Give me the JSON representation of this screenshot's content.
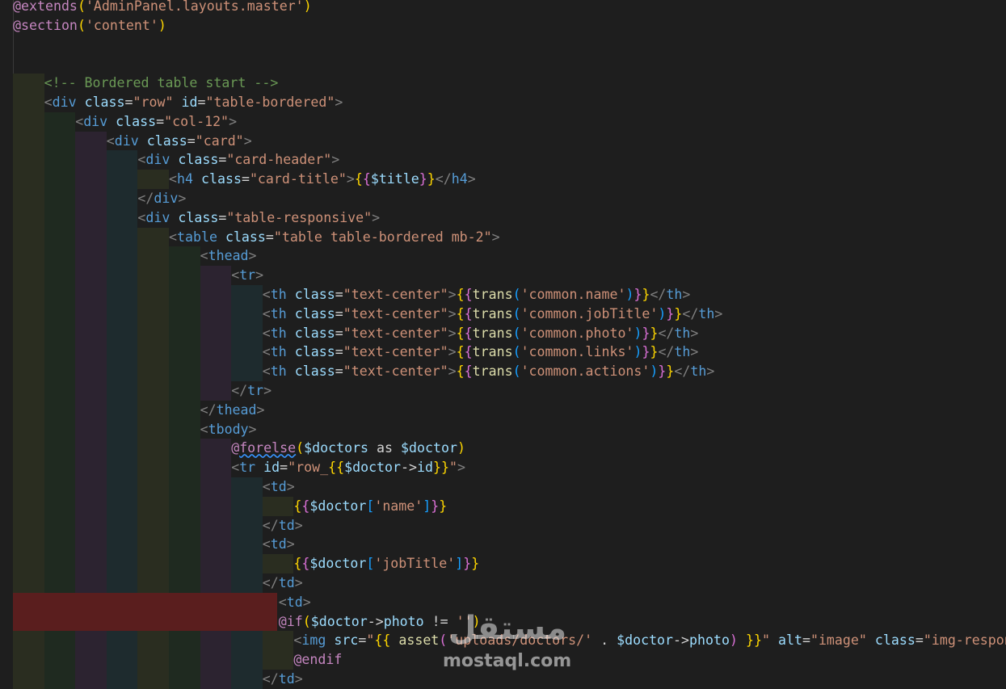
{
  "editor": {
    "lines": [
      {
        "indent": 0,
        "red": false,
        "tokens": [
          [
            "dir",
            "@extends"
          ],
          [
            "b1",
            "("
          ],
          [
            "str",
            "'AdminPanel.layouts.master'"
          ],
          [
            "b1",
            ")"
          ]
        ]
      },
      {
        "indent": 0,
        "red": false,
        "tokens": [
          [
            "dir",
            "@section"
          ],
          [
            "b1",
            "("
          ],
          [
            "str",
            "'content'"
          ],
          [
            "b1",
            ")"
          ]
        ]
      },
      {
        "indent": 0,
        "red": false,
        "tokens": []
      },
      {
        "indent": 0,
        "red": false,
        "tokens": []
      },
      {
        "indent": 1,
        "red": false,
        "tokens": [
          [
            "cmt",
            "<!-- Bordered table start -->"
          ]
        ]
      },
      {
        "indent": 1,
        "red": false,
        "tokens": [
          [
            "brk",
            "<"
          ],
          [
            "kw",
            "div"
          ],
          [
            "tx",
            " "
          ],
          [
            "att",
            "class"
          ],
          [
            "tx",
            "="
          ],
          [
            "str",
            "\"row\""
          ],
          [
            "tx",
            " "
          ],
          [
            "att",
            "id"
          ],
          [
            "tx",
            "="
          ],
          [
            "str",
            "\"table-bordered\""
          ],
          [
            "brk",
            ">"
          ]
        ]
      },
      {
        "indent": 2,
        "red": false,
        "tokens": [
          [
            "brk",
            "<"
          ],
          [
            "kw",
            "div"
          ],
          [
            "tx",
            " "
          ],
          [
            "att",
            "class"
          ],
          [
            "tx",
            "="
          ],
          [
            "str",
            "\"col-12\""
          ],
          [
            "brk",
            ">"
          ]
        ]
      },
      {
        "indent": 3,
        "red": false,
        "tokens": [
          [
            "brk",
            "<"
          ],
          [
            "kw",
            "div"
          ],
          [
            "tx",
            " "
          ],
          [
            "att",
            "class"
          ],
          [
            "tx",
            "="
          ],
          [
            "str",
            "\"card\""
          ],
          [
            "brk",
            ">"
          ]
        ]
      },
      {
        "indent": 4,
        "red": false,
        "tokens": [
          [
            "brk",
            "<"
          ],
          [
            "kw",
            "div"
          ],
          [
            "tx",
            " "
          ],
          [
            "att",
            "class"
          ],
          [
            "tx",
            "="
          ],
          [
            "str",
            "\"card-header\""
          ],
          [
            "brk",
            ">"
          ]
        ]
      },
      {
        "indent": 5,
        "red": false,
        "tokens": [
          [
            "brk",
            "<"
          ],
          [
            "kw",
            "h4"
          ],
          [
            "tx",
            " "
          ],
          [
            "att",
            "class"
          ],
          [
            "tx",
            "="
          ],
          [
            "str",
            "\"card-title\""
          ],
          [
            "brk",
            ">"
          ],
          [
            "b1",
            "{"
          ],
          [
            "b2",
            "{"
          ],
          [
            "var",
            "$title"
          ],
          [
            "b2",
            "}"
          ],
          [
            "b1",
            "}"
          ],
          [
            "brk",
            "</"
          ],
          [
            "kw",
            "h4"
          ],
          [
            "brk",
            ">"
          ]
        ]
      },
      {
        "indent": 4,
        "red": false,
        "tokens": [
          [
            "brk",
            "</"
          ],
          [
            "kw",
            "div"
          ],
          [
            "brk",
            ">"
          ]
        ]
      },
      {
        "indent": 4,
        "red": false,
        "tokens": [
          [
            "brk",
            "<"
          ],
          [
            "kw",
            "div"
          ],
          [
            "tx",
            " "
          ],
          [
            "att",
            "class"
          ],
          [
            "tx",
            "="
          ],
          [
            "str",
            "\"table-responsive\""
          ],
          [
            "brk",
            ">"
          ]
        ]
      },
      {
        "indent": 5,
        "red": false,
        "tokens": [
          [
            "brk",
            "<"
          ],
          [
            "kw",
            "table"
          ],
          [
            "tx",
            " "
          ],
          [
            "att",
            "class"
          ],
          [
            "tx",
            "="
          ],
          [
            "str",
            "\"table table-bordered mb-2\""
          ],
          [
            "brk",
            ">"
          ]
        ]
      },
      {
        "indent": 6,
        "red": false,
        "tokens": [
          [
            "brk",
            "<"
          ],
          [
            "kw",
            "thead"
          ],
          [
            "brk",
            ">"
          ]
        ]
      },
      {
        "indent": 7,
        "red": false,
        "tokens": [
          [
            "brk",
            "<"
          ],
          [
            "kw",
            "tr"
          ],
          [
            "brk",
            ">"
          ]
        ]
      },
      {
        "indent": 8,
        "red": false,
        "tokens": [
          [
            "brk",
            "<"
          ],
          [
            "kw",
            "th"
          ],
          [
            "tx",
            " "
          ],
          [
            "att",
            "class"
          ],
          [
            "tx",
            "="
          ],
          [
            "str",
            "\"text-center\""
          ],
          [
            "brk",
            ">"
          ],
          [
            "b1",
            "{"
          ],
          [
            "b2",
            "{"
          ],
          [
            "fn",
            "trans"
          ],
          [
            "b3",
            "("
          ],
          [
            "str",
            "'common.name'"
          ],
          [
            "b3",
            ")"
          ],
          [
            "b2",
            "}"
          ],
          [
            "b1",
            "}"
          ],
          [
            "brk",
            "</"
          ],
          [
            "kw",
            "th"
          ],
          [
            "brk",
            ">"
          ]
        ]
      },
      {
        "indent": 8,
        "red": false,
        "tokens": [
          [
            "brk",
            "<"
          ],
          [
            "kw",
            "th"
          ],
          [
            "tx",
            " "
          ],
          [
            "att",
            "class"
          ],
          [
            "tx",
            "="
          ],
          [
            "str",
            "\"text-center\""
          ],
          [
            "brk",
            ">"
          ],
          [
            "b1",
            "{"
          ],
          [
            "b2",
            "{"
          ],
          [
            "fn",
            "trans"
          ],
          [
            "b3",
            "("
          ],
          [
            "str",
            "'common.jobTitle'"
          ],
          [
            "b3",
            ")"
          ],
          [
            "b2",
            "}"
          ],
          [
            "b1",
            "}"
          ],
          [
            "brk",
            "</"
          ],
          [
            "kw",
            "th"
          ],
          [
            "brk",
            ">"
          ]
        ]
      },
      {
        "indent": 8,
        "red": false,
        "tokens": [
          [
            "brk",
            "<"
          ],
          [
            "kw",
            "th"
          ],
          [
            "tx",
            " "
          ],
          [
            "att",
            "class"
          ],
          [
            "tx",
            "="
          ],
          [
            "str",
            "\"text-center\""
          ],
          [
            "brk",
            ">"
          ],
          [
            "b1",
            "{"
          ],
          [
            "b2",
            "{"
          ],
          [
            "fn",
            "trans"
          ],
          [
            "b3",
            "("
          ],
          [
            "str",
            "'common.photo'"
          ],
          [
            "b3",
            ")"
          ],
          [
            "b2",
            "}"
          ],
          [
            "b1",
            "}"
          ],
          [
            "brk",
            "</"
          ],
          [
            "kw",
            "th"
          ],
          [
            "brk",
            ">"
          ]
        ]
      },
      {
        "indent": 8,
        "red": false,
        "tokens": [
          [
            "brk",
            "<"
          ],
          [
            "kw",
            "th"
          ],
          [
            "tx",
            " "
          ],
          [
            "att",
            "class"
          ],
          [
            "tx",
            "="
          ],
          [
            "str",
            "\"text-center\""
          ],
          [
            "brk",
            ">"
          ],
          [
            "b1",
            "{"
          ],
          [
            "b2",
            "{"
          ],
          [
            "fn",
            "trans"
          ],
          [
            "b3",
            "("
          ],
          [
            "str",
            "'common.links'"
          ],
          [
            "b3",
            ")"
          ],
          [
            "b2",
            "}"
          ],
          [
            "b1",
            "}"
          ],
          [
            "brk",
            "</"
          ],
          [
            "kw",
            "th"
          ],
          [
            "brk",
            ">"
          ]
        ]
      },
      {
        "indent": 8,
        "red": false,
        "tokens": [
          [
            "brk",
            "<"
          ],
          [
            "kw",
            "th"
          ],
          [
            "tx",
            " "
          ],
          [
            "att",
            "class"
          ],
          [
            "tx",
            "="
          ],
          [
            "str",
            "\"text-center\""
          ],
          [
            "brk",
            ">"
          ],
          [
            "b1",
            "{"
          ],
          [
            "b2",
            "{"
          ],
          [
            "fn",
            "trans"
          ],
          [
            "b3",
            "("
          ],
          [
            "str",
            "'common.actions'"
          ],
          [
            "b3",
            ")"
          ],
          [
            "b2",
            "}"
          ],
          [
            "b1",
            "}"
          ],
          [
            "brk",
            "</"
          ],
          [
            "kw",
            "th"
          ],
          [
            "brk",
            ">"
          ]
        ]
      },
      {
        "indent": 7,
        "red": false,
        "tokens": [
          [
            "brk",
            "</"
          ],
          [
            "kw",
            "tr"
          ],
          [
            "brk",
            ">"
          ]
        ]
      },
      {
        "indent": 6,
        "red": false,
        "tokens": [
          [
            "brk",
            "</"
          ],
          [
            "kw",
            "thead"
          ],
          [
            "brk",
            ">"
          ]
        ]
      },
      {
        "indent": 6,
        "red": false,
        "tokens": [
          [
            "brk",
            "<"
          ],
          [
            "kw",
            "tbody"
          ],
          [
            "brk",
            ">"
          ]
        ]
      },
      {
        "indent": 7,
        "red": false,
        "tokens": [
          [
            "dir",
            "@forelse"
          ],
          [
            "b1",
            "("
          ],
          [
            "var",
            "$doctors"
          ],
          [
            "tx",
            " as "
          ],
          [
            "var",
            "$doctor"
          ],
          [
            "b1",
            ")"
          ]
        ]
      },
      {
        "indent": 7,
        "red": false,
        "tokens": [
          [
            "brk",
            "<"
          ],
          [
            "kw",
            "tr"
          ],
          [
            "tx",
            " "
          ],
          [
            "att",
            "id"
          ],
          [
            "tx",
            "="
          ],
          [
            "str",
            "\"row_"
          ],
          [
            "b1",
            "{{"
          ],
          [
            "var",
            "$doctor"
          ],
          [
            "tx",
            "->"
          ],
          [
            "var",
            "id"
          ],
          [
            "b1",
            "}}"
          ],
          [
            "str",
            "\""
          ],
          [
            "brk",
            ">"
          ]
        ]
      },
      {
        "indent": 8,
        "red": false,
        "tokens": [
          [
            "brk",
            "<"
          ],
          [
            "kw",
            "td"
          ],
          [
            "brk",
            ">"
          ]
        ]
      },
      {
        "indent": 9,
        "red": false,
        "tokens": [
          [
            "b1",
            "{"
          ],
          [
            "b2",
            "{"
          ],
          [
            "var",
            "$doctor"
          ],
          [
            "b3",
            "["
          ],
          [
            "str",
            "'name'"
          ],
          [
            "b3",
            "]"
          ],
          [
            "b2",
            "}"
          ],
          [
            "b1",
            "}"
          ]
        ]
      },
      {
        "indent": 8,
        "red": false,
        "tokens": [
          [
            "brk",
            "</"
          ],
          [
            "kw",
            "td"
          ],
          [
            "brk",
            ">"
          ]
        ]
      },
      {
        "indent": 8,
        "red": false,
        "tokens": [
          [
            "brk",
            "<"
          ],
          [
            "kw",
            "td"
          ],
          [
            "brk",
            ">"
          ]
        ]
      },
      {
        "indent": 9,
        "red": false,
        "tokens": [
          [
            "b1",
            "{"
          ],
          [
            "b2",
            "{"
          ],
          [
            "var",
            "$doctor"
          ],
          [
            "b3",
            "["
          ],
          [
            "str",
            "'jobTitle'"
          ],
          [
            "b3",
            "]"
          ],
          [
            "b2",
            "}"
          ],
          [
            "b1",
            "}"
          ]
        ]
      },
      {
        "indent": 8,
        "red": false,
        "tokens": [
          [
            "brk",
            "</"
          ],
          [
            "kw",
            "td"
          ],
          [
            "brk",
            ">"
          ]
        ]
      },
      {
        "indent": 8,
        "red": true,
        "tokens": [
          [
            "brk",
            "<"
          ],
          [
            "kw",
            "td"
          ],
          [
            "brk",
            ">"
          ]
        ]
      },
      {
        "indent": 8,
        "red": true,
        "tokens": [
          [
            "dir",
            "@if"
          ],
          [
            "b1",
            "("
          ],
          [
            "var",
            "$doctor"
          ],
          [
            "tx",
            "->"
          ],
          [
            "var",
            "photo"
          ],
          [
            "tx",
            " != "
          ],
          [
            "str",
            "''"
          ],
          [
            "b1",
            ")"
          ]
        ]
      },
      {
        "indent": 9,
        "red": false,
        "tokens": [
          [
            "brk",
            "<"
          ],
          [
            "kw",
            "img"
          ],
          [
            "tx",
            " "
          ],
          [
            "att",
            "src"
          ],
          [
            "tx",
            "="
          ],
          [
            "str",
            "\""
          ],
          [
            "b1",
            "{{"
          ],
          [
            "tx",
            " "
          ],
          [
            "fn",
            "asset"
          ],
          [
            "b2",
            "("
          ],
          [
            "str",
            "'uploads/doctors/'"
          ],
          [
            "tx",
            " . "
          ],
          [
            "var",
            "$doctor"
          ],
          [
            "tx",
            "->"
          ],
          [
            "var",
            "photo"
          ],
          [
            "b2",
            ")"
          ],
          [
            "tx",
            " "
          ],
          [
            "b1",
            "}}"
          ],
          [
            "str",
            "\""
          ],
          [
            "tx",
            " "
          ],
          [
            "att",
            "alt"
          ],
          [
            "tx",
            "="
          ],
          [
            "str",
            "\"image\""
          ],
          [
            "tx",
            " "
          ],
          [
            "att",
            "class"
          ],
          [
            "tx",
            "="
          ],
          [
            "str",
            "\"img-responsive"
          ]
        ]
      },
      {
        "indent": 9,
        "red": false,
        "tokens": [
          [
            "dir",
            "@endif"
          ]
        ]
      },
      {
        "indent": 8,
        "red": false,
        "tokens": [
          [
            "brk",
            "</"
          ],
          [
            "kw",
            "td"
          ],
          [
            "brk",
            ">"
          ]
        ]
      }
    ]
  },
  "watermark": {
    "logo": "مستقل",
    "text": "mostaql.com"
  }
}
